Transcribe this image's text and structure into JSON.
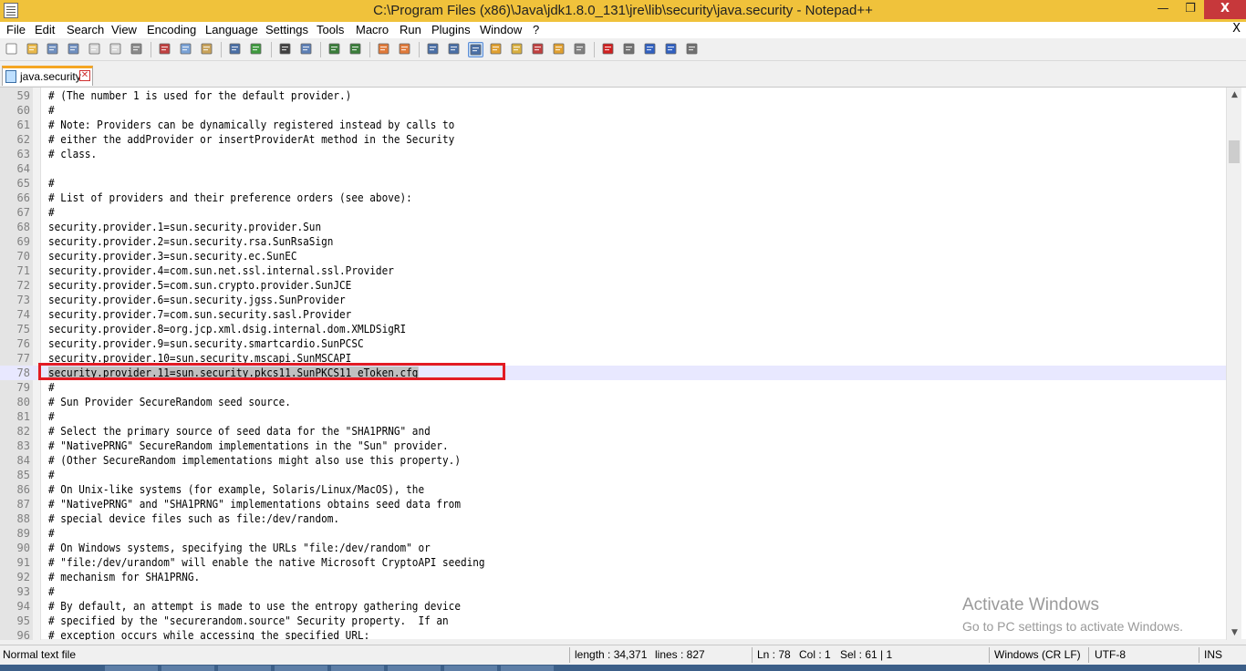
{
  "window": {
    "title": "C:\\Program Files (x86)\\Java\\jdk1.8.0_131\\jre\\lib\\security\\java.security - Notepad++",
    "min_glyph": "—",
    "max_glyph": "❐",
    "close_glyph": "X"
  },
  "menu": {
    "items": [
      "File",
      "Edit",
      "Search",
      "View",
      "Encoding",
      "Language",
      "Settings",
      "Tools",
      "Macro",
      "Run",
      "Plugins",
      "Window",
      "?"
    ],
    "close_label": "X"
  },
  "toolbar": {
    "icons": [
      {
        "name": "new-file-icon",
        "color": "#ffffff"
      },
      {
        "name": "open-file-icon",
        "color": "#e8b84a"
      },
      {
        "name": "save-icon",
        "color": "#6f8fbf"
      },
      {
        "name": "save-all-icon",
        "color": "#6f8fbf"
      },
      {
        "name": "close-file-icon",
        "color": "#d9d9d9"
      },
      {
        "name": "close-all-icon",
        "color": "#d9d9d9"
      },
      {
        "name": "print-icon",
        "color": "#8a8a8a"
      },
      {
        "name": "cut-icon",
        "color": "#c04040"
      },
      {
        "name": "copy-icon",
        "color": "#7aa2d6"
      },
      {
        "name": "paste-icon",
        "color": "#c9a35a"
      },
      {
        "name": "undo-icon",
        "color": "#4a6fa5"
      },
      {
        "name": "redo-icon",
        "color": "#3f9a3f"
      },
      {
        "name": "find-icon",
        "color": "#404040"
      },
      {
        "name": "replace-icon",
        "color": "#5c7fb5"
      },
      {
        "name": "zoom-in-icon",
        "color": "#3a7d3a"
      },
      {
        "name": "zoom-out-icon",
        "color": "#3a7d3a"
      },
      {
        "name": "sync-vertical-icon",
        "color": "#e07a3a"
      },
      {
        "name": "sync-horizontal-icon",
        "color": "#e07a3a"
      },
      {
        "name": "word-wrap-icon",
        "color": "#4a6fa5"
      },
      {
        "name": "show-all-characters-icon",
        "color": "#4a6fa5"
      },
      {
        "name": "indent-guide-icon",
        "color": "#4a6fa5"
      },
      {
        "name": "user-language-icon",
        "color": "#e0a030"
      },
      {
        "name": "document-map-icon",
        "color": "#d9b040"
      },
      {
        "name": "function-list-icon",
        "color": "#c04040"
      },
      {
        "name": "folder-as-workspace-icon",
        "color": "#e0a030"
      },
      {
        "name": "monitoring-icon",
        "color": "#808080"
      },
      {
        "name": "record-macro-icon",
        "color": "#d02020"
      },
      {
        "name": "stop-recording-icon",
        "color": "#707070"
      },
      {
        "name": "play-macro-icon",
        "color": "#3060c0"
      },
      {
        "name": "run-macro-multiple-icon",
        "color": "#3060c0"
      },
      {
        "name": "save-macro-icon",
        "color": "#707070"
      }
    ]
  },
  "tab": {
    "label": "java.security",
    "close_glyph": "✕"
  },
  "editor": {
    "lines": [
      {
        "n": "59",
        "t": "# (The number 1 is used for the default provider.)"
      },
      {
        "n": "60",
        "t": "#"
      },
      {
        "n": "61",
        "t": "# Note: Providers can be dynamically registered instead by calls to"
      },
      {
        "n": "62",
        "t": "# either the addProvider or insertProviderAt method in the Security"
      },
      {
        "n": "63",
        "t": "# class."
      },
      {
        "n": "64",
        "t": ""
      },
      {
        "n": "65",
        "t": "#"
      },
      {
        "n": "66",
        "t": "# List of providers and their preference orders (see above):"
      },
      {
        "n": "67",
        "t": "#"
      },
      {
        "n": "68",
        "t": "security.provider.1=sun.security.provider.Sun"
      },
      {
        "n": "69",
        "t": "security.provider.2=sun.security.rsa.SunRsaSign"
      },
      {
        "n": "70",
        "t": "security.provider.3=sun.security.ec.SunEC"
      },
      {
        "n": "71",
        "t": "security.provider.4=com.sun.net.ssl.internal.ssl.Provider"
      },
      {
        "n": "72",
        "t": "security.provider.5=com.sun.crypto.provider.SunJCE"
      },
      {
        "n": "73",
        "t": "security.provider.6=sun.security.jgss.SunProvider"
      },
      {
        "n": "74",
        "t": "security.provider.7=com.sun.security.sasl.Provider"
      },
      {
        "n": "75",
        "t": "security.provider.8=org.jcp.xml.dsig.internal.dom.XMLDSigRI"
      },
      {
        "n": "76",
        "t": "security.provider.9=sun.security.smartcardio.SunPCSC"
      },
      {
        "n": "77",
        "t": "security.provider.10=sun.security.mscapi.SunMSCAPI"
      },
      {
        "n": "78",
        "t": "security.provider.11=sun.security.pkcs11.SunPKCS11 eToken.cfg",
        "current": true
      },
      {
        "n": "79",
        "t": "#"
      },
      {
        "n": "80",
        "t": "# Sun Provider SecureRandom seed source."
      },
      {
        "n": "81",
        "t": "#"
      },
      {
        "n": "82",
        "t": "# Select the primary source of seed data for the \"SHA1PRNG\" and"
      },
      {
        "n": "83",
        "t": "# \"NativePRNG\" SecureRandom implementations in the \"Sun\" provider."
      },
      {
        "n": "84",
        "t": "# (Other SecureRandom implementations might also use this property.)"
      },
      {
        "n": "85",
        "t": "#"
      },
      {
        "n": "86",
        "t": "# On Unix-like systems (for example, Solaris/Linux/MacOS), the"
      },
      {
        "n": "87",
        "t": "# \"NativePRNG\" and \"SHA1PRNG\" implementations obtains seed data from"
      },
      {
        "n": "88",
        "t": "# special device files such as file:/dev/random."
      },
      {
        "n": "89",
        "t": "#"
      },
      {
        "n": "90",
        "t": "# On Windows systems, specifying the URLs \"file:/dev/random\" or"
      },
      {
        "n": "91",
        "t": "# \"file:/dev/urandom\" will enable the native Microsoft CryptoAPI seeding"
      },
      {
        "n": "92",
        "t": "# mechanism for SHA1PRNG."
      },
      {
        "n": "93",
        "t": "#"
      },
      {
        "n": "94",
        "t": "# By default, an attempt is made to use the entropy gathering device"
      },
      {
        "n": "95",
        "t": "# specified by the \"securerandom.source\" Security property.  If an"
      },
      {
        "n": "96",
        "t": "# exception occurs while accessing the specified URL:"
      }
    ]
  },
  "watermark": {
    "line1": "Activate Windows",
    "line2": "Go to PC settings to activate Windows."
  },
  "status": {
    "file_type": "Normal text file",
    "length": "length : 34,371",
    "lines": "lines : 827",
    "ln": "Ln : 78",
    "col": "Col : 1",
    "sel": "Sel : 61 | 1",
    "eol": "Windows (CR LF)",
    "encoding": "UTF-8",
    "mode": "INS"
  }
}
